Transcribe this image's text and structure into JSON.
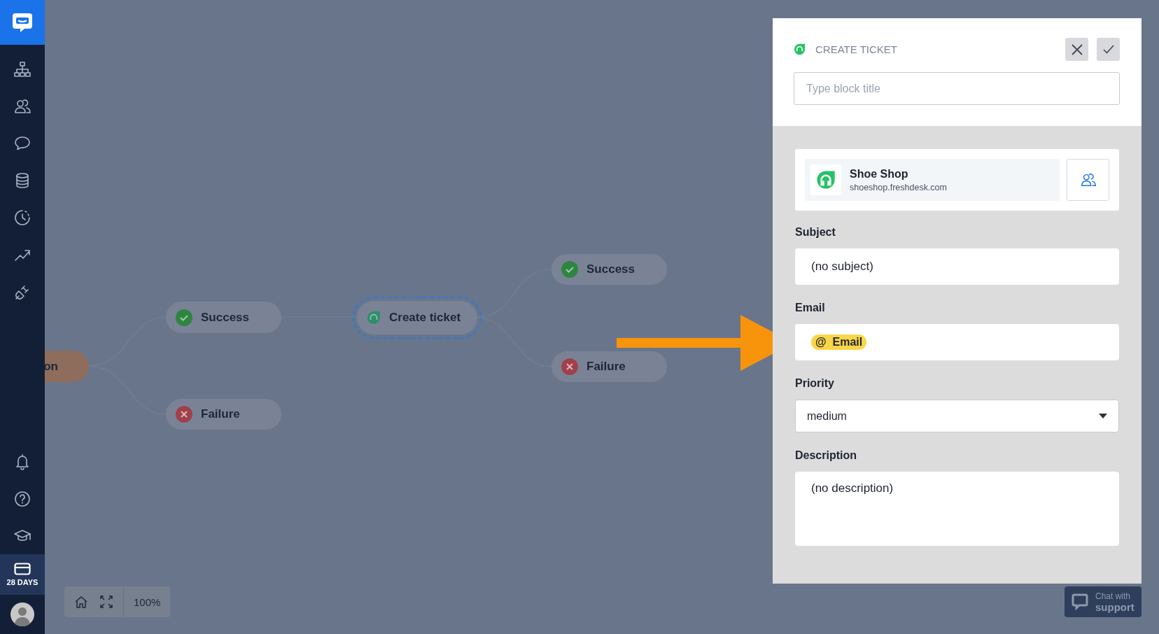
{
  "sidebar": {
    "trial_badge": "28 DAYS"
  },
  "canvas": {
    "nodes": [
      {
        "kind": "action",
        "label": "on",
        "selected": false
      },
      {
        "kind": "success",
        "label": "Success",
        "selected": false
      },
      {
        "kind": "failure",
        "label": "Failure",
        "selected": false
      },
      {
        "kind": "integration",
        "label": "Create ticket",
        "selected": true
      },
      {
        "kind": "success",
        "label": "Success",
        "selected": false
      },
      {
        "kind": "failure",
        "label": "Failure",
        "selected": false
      }
    ]
  },
  "zoom_controls": {
    "zoom": "100%"
  },
  "panel": {
    "title": "CREATE TICKET",
    "title_field": {
      "placeholder": "Type block title"
    },
    "account": {
      "name": "Shoe Shop",
      "domain": "shoeshop.freshdesk.com"
    },
    "fields": [
      {
        "kind": "text",
        "label": "Subject",
        "value": "(no subject)"
      },
      {
        "kind": "token",
        "label": "Email",
        "symbol": "@",
        "value": "Email"
      },
      {
        "kind": "select",
        "label": "Priority",
        "value": "medium"
      },
      {
        "kind": "textarea",
        "label": "Description",
        "value": "(no description)"
      }
    ]
  },
  "chat_button": {
    "line_1": "Chat with",
    "line_2": "support"
  }
}
